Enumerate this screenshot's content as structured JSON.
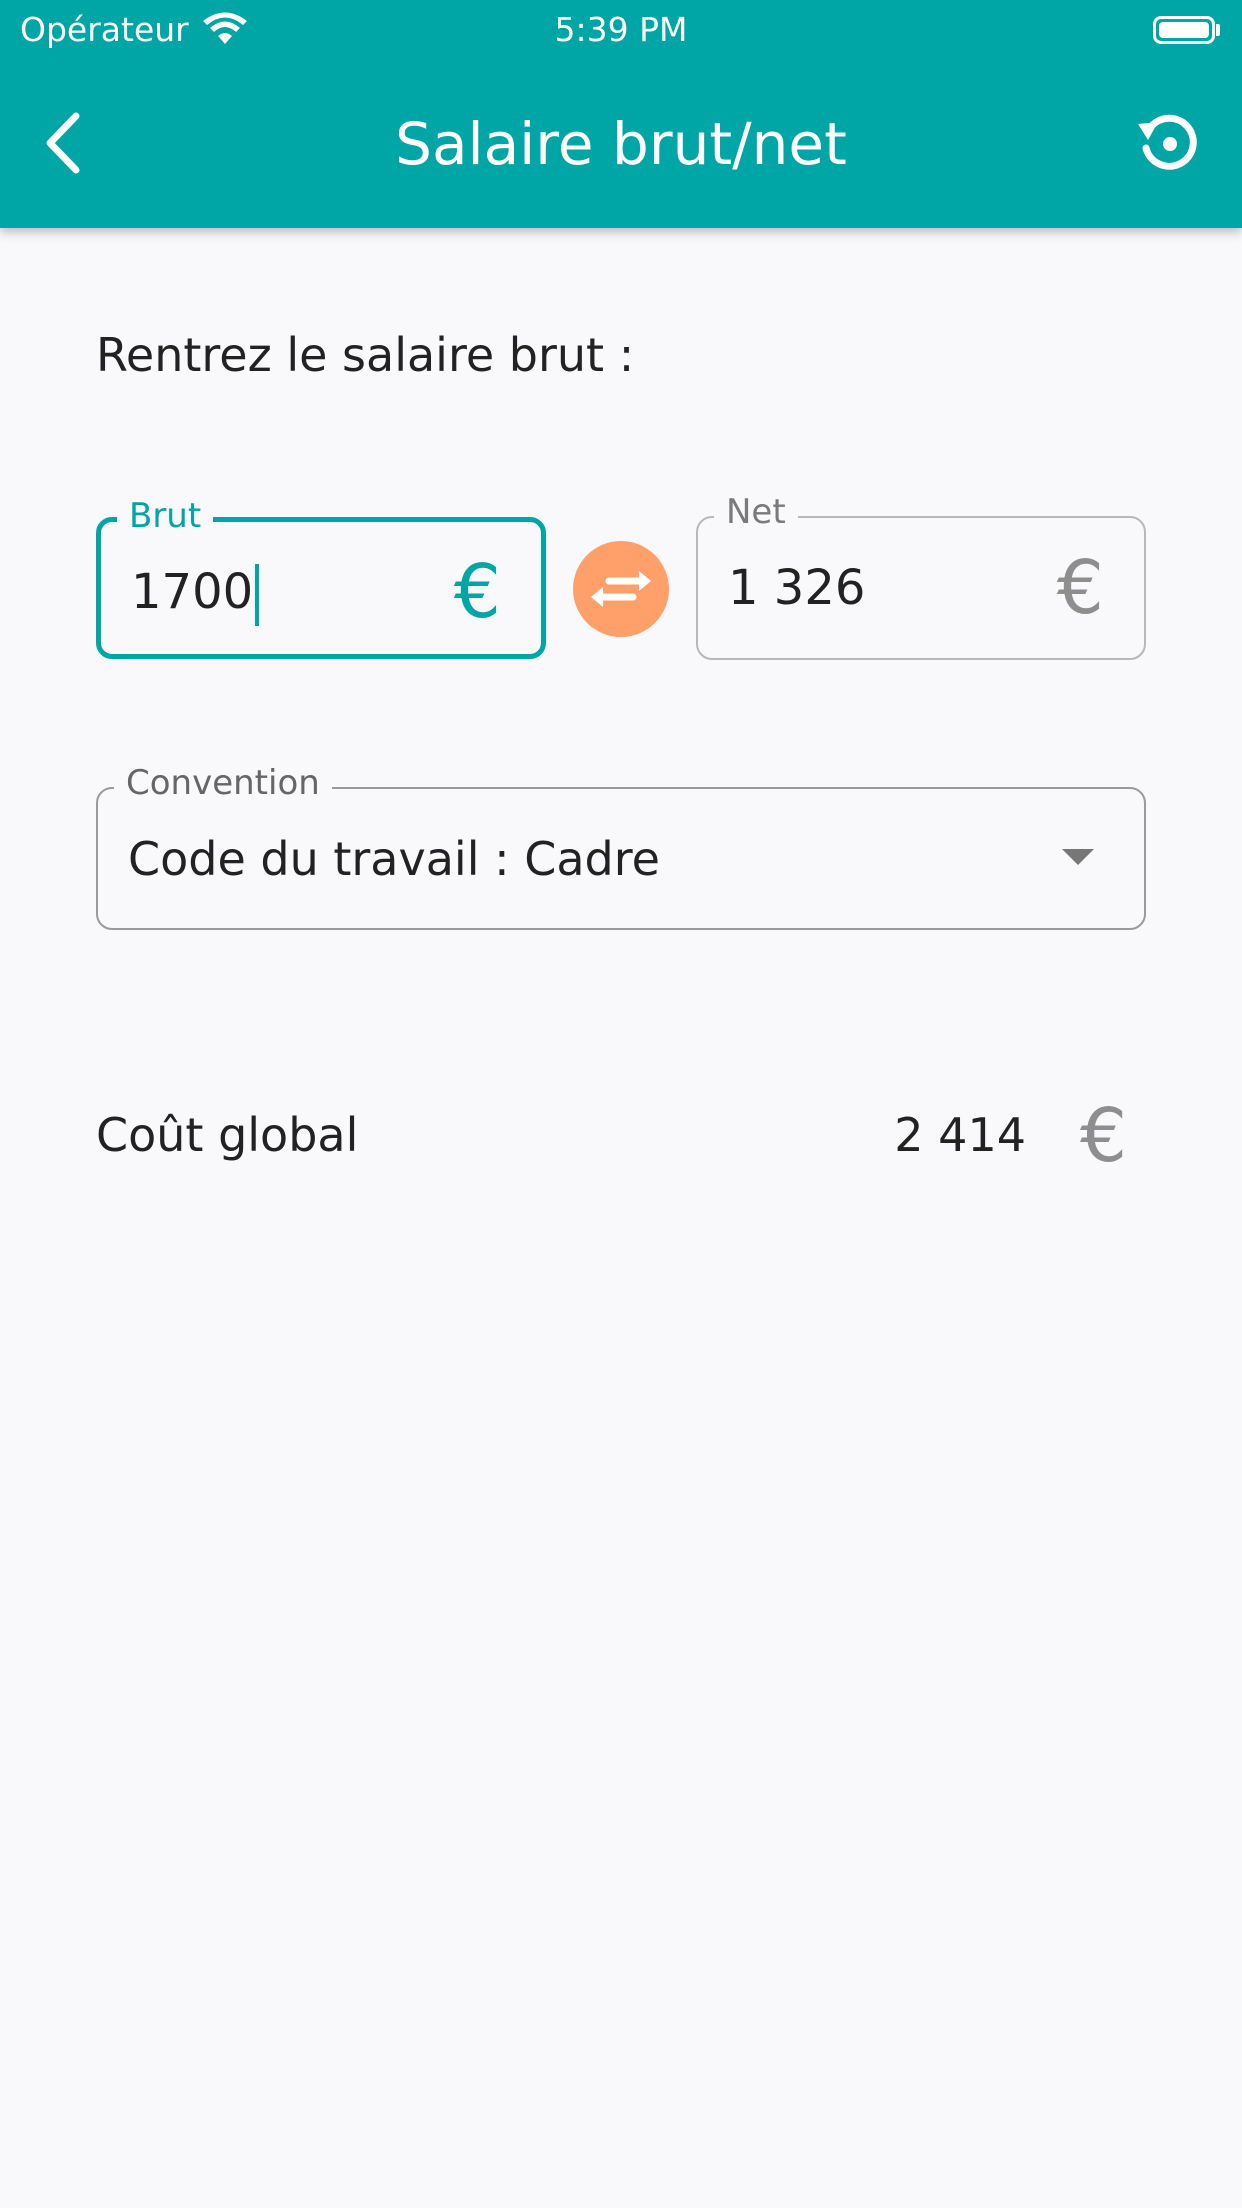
{
  "status_bar": {
    "carrier": "Opérateur",
    "time": "5:39 PM"
  },
  "header": {
    "title": "Salaire brut/net",
    "back_icon": "chevron-left-icon",
    "reset_icon": "history-reset-icon"
  },
  "form": {
    "prompt": "Rentrez le salaire brut :",
    "brut": {
      "label": "Brut",
      "value": "1700",
      "currency": "€"
    },
    "swap_icon": "swap-arrows-icon",
    "net": {
      "label": "Net",
      "value": "1 326",
      "currency": "€"
    },
    "convention": {
      "label": "Convention",
      "selected": "Code du travail : Cadre"
    }
  },
  "result": {
    "label": "Coût global",
    "value": "2 414",
    "currency": "€"
  },
  "colors": {
    "primary": "#00a5a5",
    "swap_button": "#ffa06a",
    "background": "#f9f8fa"
  }
}
